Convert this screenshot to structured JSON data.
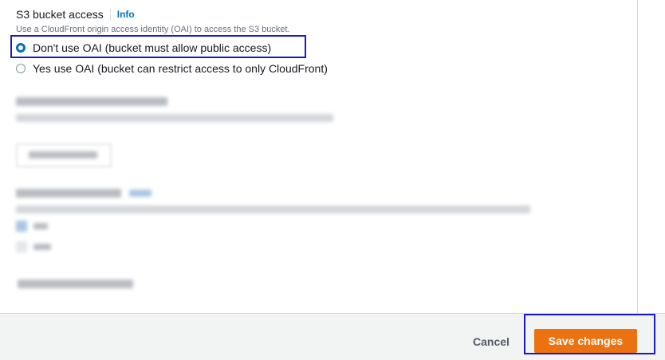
{
  "section": {
    "title": "S3 bucket access",
    "info_link": "Info",
    "description": "Use a CloudFront origin access identity (OAI) to access the S3 bucket."
  },
  "options": [
    {
      "label": "Don't use OAI (bucket must allow public access)",
      "selected": true
    },
    {
      "label": "Yes use OAI (bucket can restrict access to only CloudFront)",
      "selected": false
    }
  ],
  "footer": {
    "cancel_label": "Cancel",
    "save_label": "Save changes"
  },
  "colors": {
    "accent": "#0073bb",
    "primary_button": "#ec7211",
    "highlight_box": "#1a1acc"
  }
}
